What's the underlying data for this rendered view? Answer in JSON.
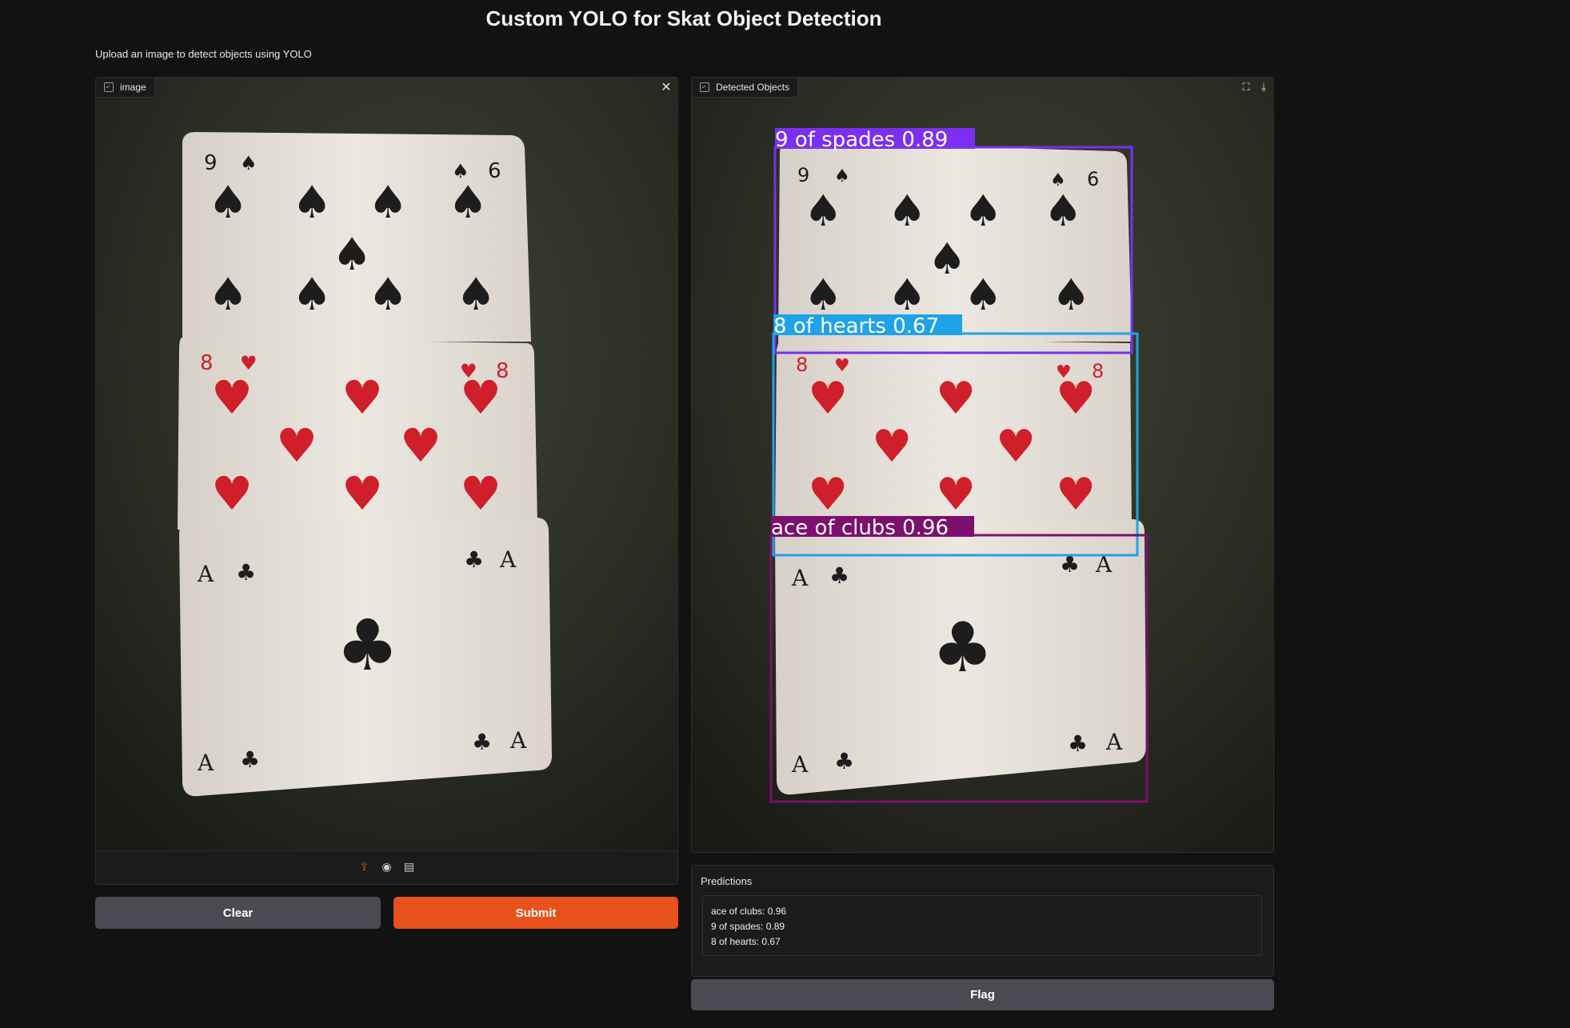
{
  "app": {
    "title": "Custom YOLO for Skat Object Detection",
    "description": "Upload an image to detect objects using YOLO"
  },
  "input_panel": {
    "label": "image",
    "close_icon": "close-icon",
    "toolbar_icons": [
      "upload-icon",
      "webcam-icon",
      "clipboard-icon"
    ]
  },
  "output_panel": {
    "label": "Detected Objects",
    "fullscreen_icon": "fullscreen-icon",
    "download_icon": "download-icon",
    "detections": [
      {
        "label": "9 of spades 0.89",
        "color": "#7b2ff0"
      },
      {
        "label": "8 of hearts 0.67",
        "color": "#1fa3e8"
      },
      {
        "label": "ace of clubs 0.96",
        "color": "#7d0f6e"
      }
    ]
  },
  "buttons": {
    "clear": "Clear",
    "submit": "Submit",
    "flag": "Flag"
  },
  "predictions": {
    "label": "Predictions",
    "lines": [
      "ace of clubs: 0.96",
      "9 of spades: 0.89",
      "8 of hearts: 0.67"
    ]
  },
  "colors": {
    "accent": "#e8511c",
    "background": "#121212",
    "panel": "#1b1b1b"
  }
}
